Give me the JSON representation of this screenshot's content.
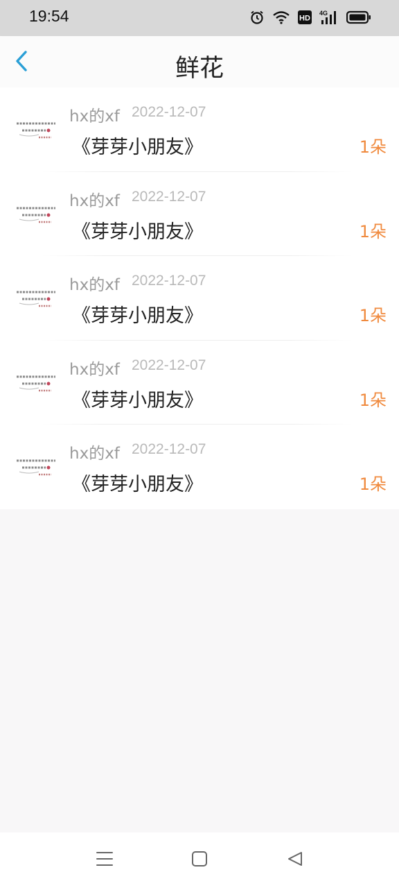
{
  "status_bar": {
    "time": "19:54",
    "icons": [
      "alarm-icon",
      "wifi-icon",
      "hd-icon",
      "signal-4g-icon",
      "battery-icon"
    ],
    "hd_text": "HD",
    "network_text": "4G"
  },
  "header": {
    "title": "鲜花",
    "back_icon": "chevron-left-icon",
    "accent_color": "#2a9fd6"
  },
  "list": {
    "items": [
      {
        "author": "hx的xf",
        "date": "2022-12-07",
        "title": "《芽芽小朋友》",
        "count": "1朵"
      },
      {
        "author": "hx的xf",
        "date": "2022-12-07",
        "title": "《芽芽小朋友》",
        "count": "1朵"
      },
      {
        "author": "hx的xf",
        "date": "2022-12-07",
        "title": "《芽芽小朋友》",
        "count": "1朵"
      },
      {
        "author": "hx的xf",
        "date": "2022-12-07",
        "title": "《芽芽小朋友》",
        "count": "1朵"
      },
      {
        "author": "hx的xf",
        "date": "2022-12-07",
        "title": "《芽芽小朋友》",
        "count": "1朵"
      }
    ],
    "count_color": "#f08a3e"
  },
  "system_nav": {
    "icons": [
      "menu-icon",
      "home-square-icon",
      "back-triangle-icon"
    ]
  }
}
